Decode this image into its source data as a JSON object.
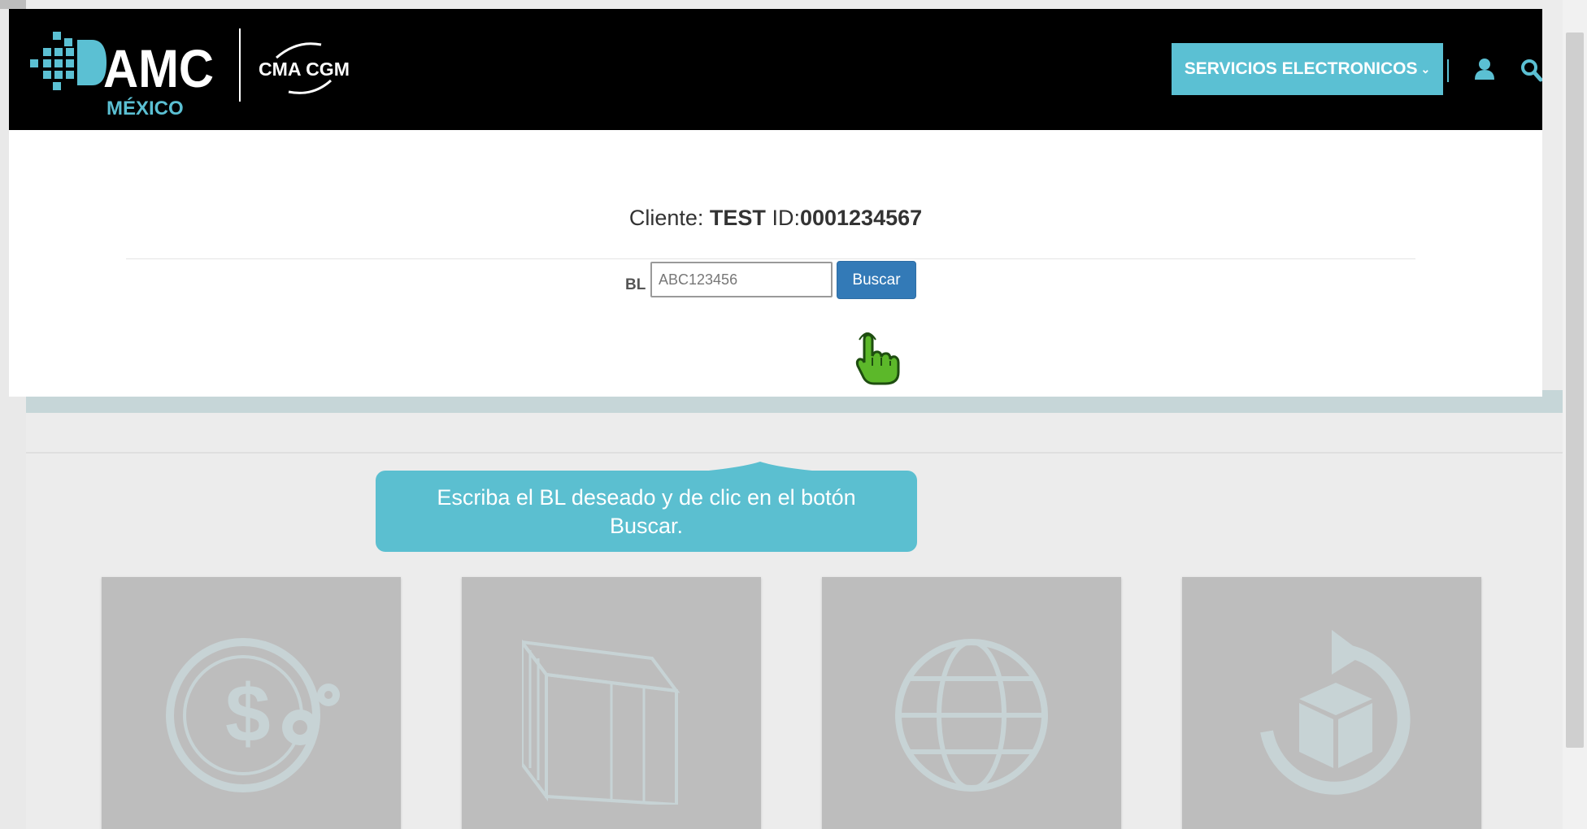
{
  "header": {
    "logo_text": "AMC",
    "logo_sub": "MÉXICO",
    "partner_logo": "CMA CGM",
    "services_button": "SERVICIOS ELECTRONICOS",
    "services_chevron": "⌄",
    "user_icon": "user-icon",
    "search_icon": "search-icon"
  },
  "client": {
    "label": "Cliente:",
    "name": "TEST",
    "id_label": "ID:",
    "id_value": "0001234567"
  },
  "search": {
    "label": "BL",
    "placeholder": "ABC123456",
    "button": "Buscar"
  },
  "tooltip": {
    "text": "Escriba el BL deseado y de clic en el botón Buscar."
  },
  "tiles": [
    {
      "icon": "money-gear-icon"
    },
    {
      "icon": "container-icon"
    },
    {
      "icon": "globe-icon"
    },
    {
      "icon": "box-refresh-icon"
    }
  ],
  "colors": {
    "accent": "#5bc0d3",
    "primary_button": "#337ab7",
    "topbar": "#000000",
    "tooltip": "#5bbfd0",
    "cursor": "#5cb82a"
  }
}
